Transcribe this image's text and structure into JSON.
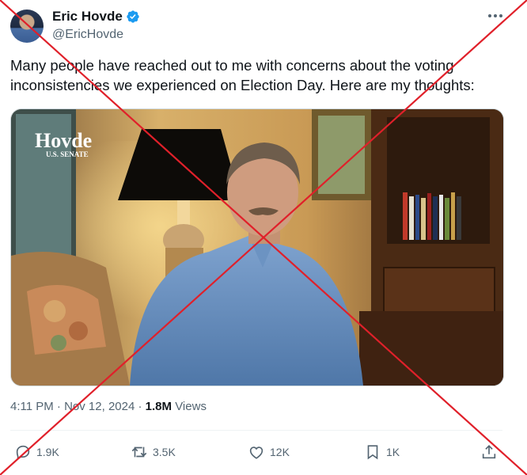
{
  "author": {
    "name": "Eric Hovde",
    "handle": "@EricHovde"
  },
  "tweet": {
    "text": "Many people have reached out to me with concerns about the voting inconsistencies we experienced on Election Day. Here are my thoughts:"
  },
  "media": {
    "logo": "Hovde",
    "logo_sub": "U.S. SENATE"
  },
  "meta": {
    "time": "4:11 PM",
    "date": "Nov 12, 2024",
    "views_count": "1.8M",
    "views_label": "Views"
  },
  "actions": {
    "replies": "1.9K",
    "reposts": "3.5K",
    "likes": "12K",
    "bookmarks": "1K"
  },
  "icons": {
    "verified": "verified-badge-icon",
    "more": "more-dots-icon",
    "reply": "reply-icon",
    "repost": "repost-icon",
    "like": "heart-icon",
    "bookmark": "bookmark-icon",
    "share": "share-icon"
  },
  "colors": {
    "verified_blue": "#1d9bf0",
    "text_secondary": "#536471",
    "overlay_cross": "#e0202a"
  }
}
